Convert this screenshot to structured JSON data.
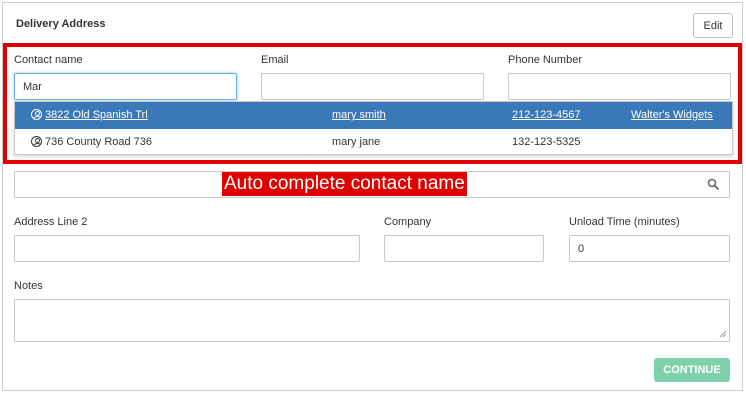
{
  "card": {
    "title": "Delivery Address",
    "edit_label": "Edit"
  },
  "contact": {
    "name_label": "Contact name",
    "name_value": "Mar",
    "email_label": "Email",
    "email_value": "",
    "phone_label": "Phone Number",
    "phone_value": ""
  },
  "autocomplete": {
    "items": [
      {
        "icon": "person-icon",
        "address": "3822 Old Spanish Trl",
        "name": "mary smith",
        "phone": "212-123-4567",
        "company": "Walter's Widgets",
        "highlighted": true
      },
      {
        "icon": "person-icon",
        "address": "736 County Road 736",
        "name": "mary jane",
        "phone": "132-123-5325",
        "company": "",
        "highlighted": false
      }
    ]
  },
  "annotation": {
    "text": "Auto complete contact name",
    "color": "#e00000"
  },
  "address": {
    "search_value": "",
    "search_icon": "search-icon",
    "line2_label": "Address Line 2",
    "line2_value": "",
    "company_label": "Company",
    "company_value": "",
    "unload_label": "Unload Time (minutes)",
    "unload_value": "0"
  },
  "notes": {
    "label": "Notes",
    "value": ""
  },
  "actions": {
    "continue_label": "CONTINUE",
    "continue_color": "#7fd1ac"
  },
  "colors": {
    "highlight_row": "#3a78b8",
    "focus_border": "#66afe9"
  }
}
